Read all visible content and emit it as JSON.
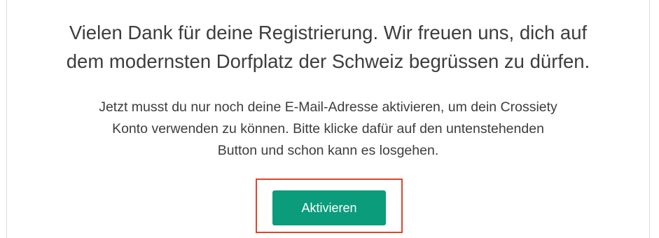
{
  "headline": {
    "line1": "Vielen Dank für deine Registrierung. Wir freuen uns, dich auf",
    "line2": "dem modernsten Dorfplatz der Schweiz begrüssen zu dürfen."
  },
  "message": {
    "line1": "Jetzt musst du nur noch deine E-Mail-Adresse aktivieren, um dein Crossiety",
    "line2": "Konto verwenden zu können. Bitte klicke dafür auf den untenstehenden",
    "line3": "Button und schon kann es losgehen."
  },
  "button": {
    "label": "Aktivieren"
  },
  "colors": {
    "accent": "#0b9c7b",
    "highlight": "#e0442b",
    "text": "#3d3d3d"
  }
}
